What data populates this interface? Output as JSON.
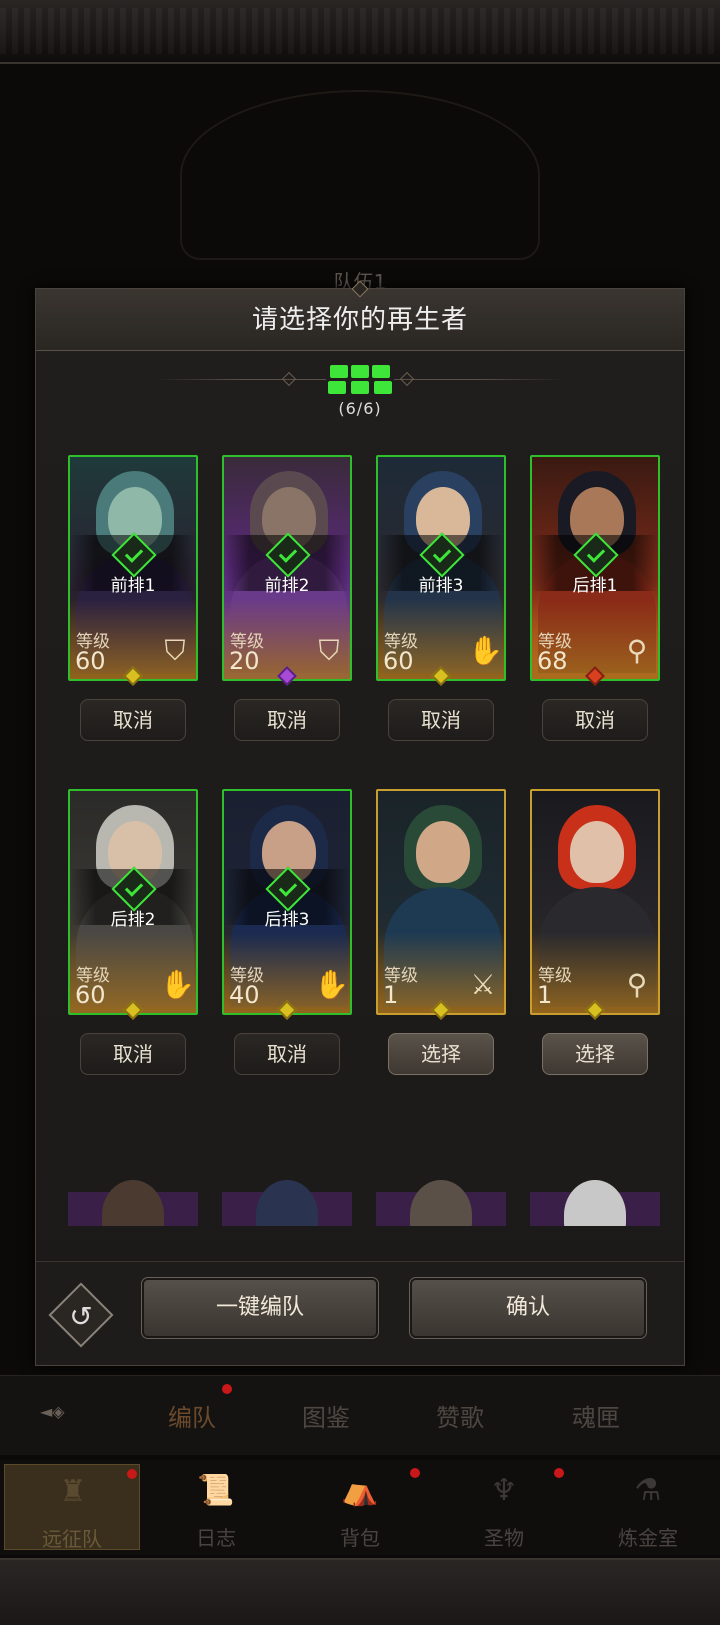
{
  "background": {
    "team_label": "队伍1"
  },
  "dialog": {
    "title": "请选择你的再生者",
    "counter": "(6/6)",
    "slots_filled": 6,
    "slots_total": 6,
    "accent_green": "#3ee63a",
    "row1": [
      {
        "position": "前排1",
        "level_label": "等级",
        "level": "60",
        "role": "shield-icon",
        "button": "取消",
        "selected": true,
        "rarity": "gold"
      },
      {
        "position": "前排2",
        "level_label": "等级",
        "level": "20",
        "role": "shield-icon",
        "button": "取消",
        "selected": true,
        "rarity": "purple"
      },
      {
        "position": "前排3",
        "level_label": "等级",
        "level": "60",
        "role": "hand-icon",
        "button": "取消",
        "selected": true,
        "rarity": "gold"
      },
      {
        "position": "后排1",
        "level_label": "等级",
        "level": "68",
        "role": "staff-icon",
        "button": "取消",
        "selected": true,
        "rarity": "red"
      }
    ],
    "row2": [
      {
        "position": "后排2",
        "level_label": "等级",
        "level": "60",
        "role": "hand-icon",
        "button": "取消",
        "selected": true,
        "rarity": "gold"
      },
      {
        "position": "后排3",
        "level_label": "等级",
        "level": "40",
        "role": "hand-icon",
        "button": "取消",
        "selected": true,
        "rarity": "gold"
      },
      {
        "position": "",
        "level_label": "等级",
        "level": "1",
        "role": "sword-icon",
        "button": "选择",
        "selected": false,
        "rarity": "gold"
      },
      {
        "position": "",
        "level_label": "等级",
        "level": "1",
        "role": "staff-icon",
        "button": "选择",
        "selected": false,
        "rarity": "gold"
      }
    ],
    "footer": {
      "auto_button": "一键编队",
      "confirm_button": "确认"
    }
  },
  "sub_tabs": [
    "编队",
    "图鉴",
    "赞歌",
    "魂匣"
  ],
  "bottom_nav": [
    "远征队",
    "日志",
    "背包",
    "圣物",
    "炼金室"
  ]
}
